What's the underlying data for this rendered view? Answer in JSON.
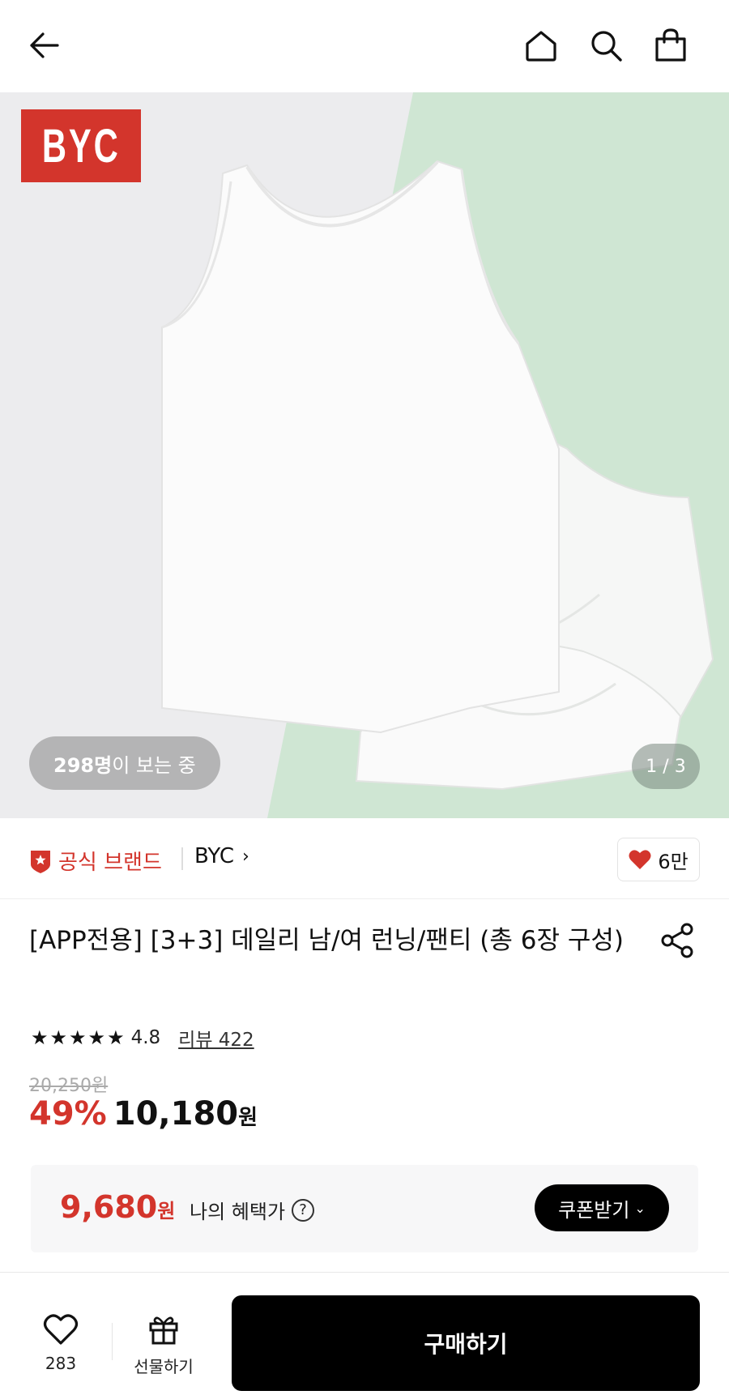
{
  "header": {
    "back_icon": "arrow-left-icon",
    "home_icon": "home-icon",
    "search_icon": "search-icon",
    "cart_icon": "shopping-bag-icon"
  },
  "hero": {
    "logo_text": "BYC",
    "viewers_count": "298명",
    "viewers_suffix": "이 보는 중",
    "pager": "1 / 3"
  },
  "brand": {
    "badge_label": "공식 브랜드",
    "name": "BYC",
    "like_count": "6만"
  },
  "product": {
    "title": "[APP전용] [3+3] 데일리 남/여 런닝/팬티 (총 6장 구성)",
    "rating": "4.8",
    "rating_stars": 5,
    "review_link": "리뷰 422",
    "original_price": "20,250원",
    "discount": "49%",
    "sale_price": "10,180",
    "currency": "원"
  },
  "benefit": {
    "price": "9,680",
    "currency": "원",
    "label": "나의 혜택가",
    "coupon_button": "쿠폰받기"
  },
  "bottom": {
    "wish_count": "283",
    "gift_label": "선물하기",
    "buy_button": "구매하기"
  },
  "colors": {
    "accent": "#d3352c",
    "buy_bg": "#000000",
    "hero_bg_left": "#ececee",
    "hero_bg_right": "#cfe6d3"
  }
}
